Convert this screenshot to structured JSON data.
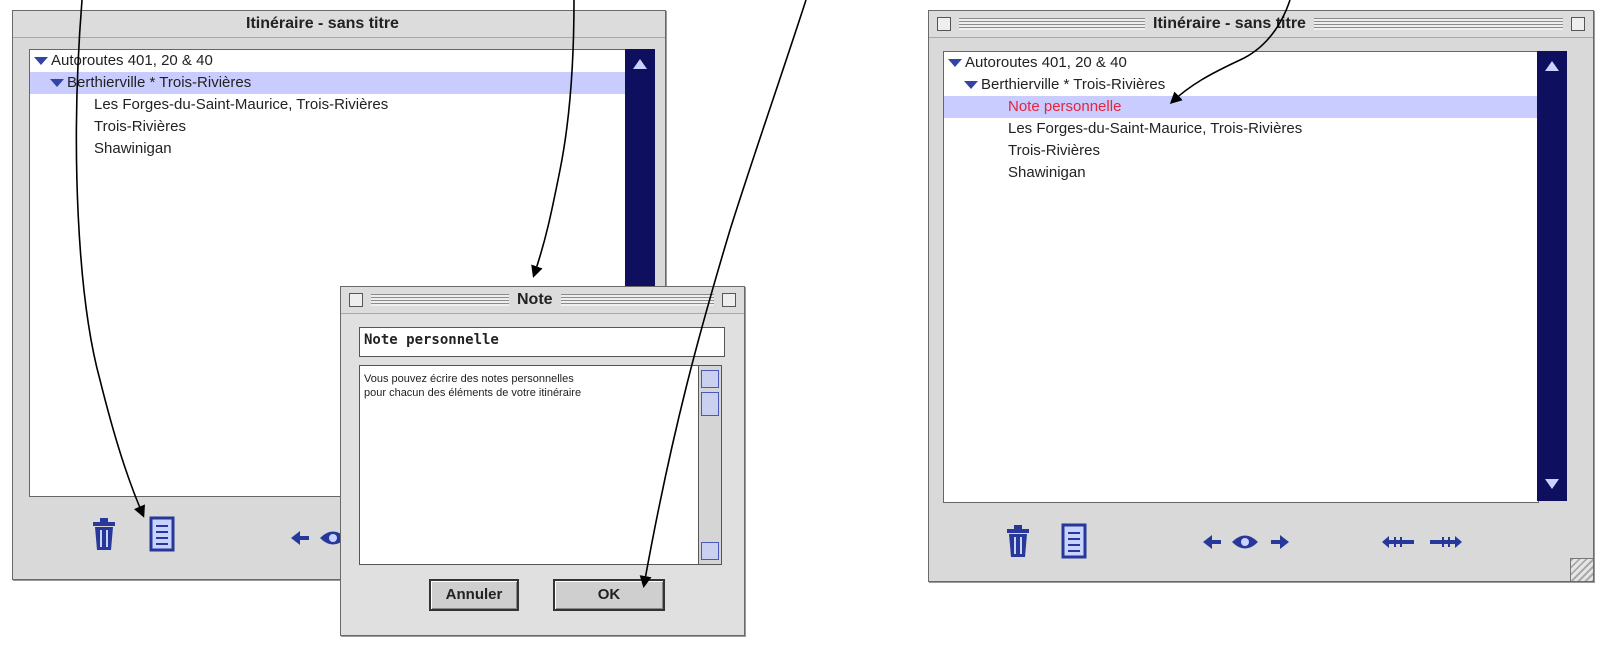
{
  "left_window": {
    "title": "Itinéraire - sans titre",
    "tree": [
      {
        "label": "Autoroutes 401, 20 & 40",
        "level": 0,
        "expanded": true
      },
      {
        "label": "Berthierville  *  Trois-Rivières",
        "level": 1,
        "expanded": true,
        "selected": true
      },
      {
        "label": "Les Forges-du-Saint-Maurice, Trois-Rivières",
        "level": 2
      },
      {
        "label": "Trois-Rivières",
        "level": 2
      },
      {
        "label": "Shawinigan",
        "level": 2
      }
    ]
  },
  "note_dialog": {
    "title": "Note",
    "name_value": "Note personnelle",
    "body_line1": "Vous pouvez écrire des notes personnelles",
    "body_line2": "pour chacun des éléments de votre itinéraire",
    "cancel_label": "Annuler",
    "ok_label": "OK"
  },
  "right_window": {
    "title": "Itinéraire - sans titre",
    "tree": [
      {
        "label": "Autoroutes 401, 20 & 40",
        "level": 0,
        "expanded": true
      },
      {
        "label": "Berthierville  *  Trois-Rivières",
        "level": 1,
        "expanded": true
      },
      {
        "label": "Note personnelle",
        "level": 2,
        "selected": true,
        "color": "#e8233b"
      },
      {
        "label": "Les Forges-du-Saint-Maurice, Trois-Rivières",
        "level": 2
      },
      {
        "label": "Trois-Rivières",
        "level": 2
      },
      {
        "label": "Shawinigan",
        "level": 2
      }
    ]
  },
  "colors": {
    "accent": "#27389a",
    "scrollbar": "#0f0f60",
    "selection": "#c9ccff",
    "note_text": "#e8233b"
  },
  "icons": [
    "trash-icon",
    "note-icon",
    "arrow-left-icon",
    "eye-icon",
    "arrow-right-icon",
    "rewind-icon",
    "fast-forward-icon"
  ]
}
